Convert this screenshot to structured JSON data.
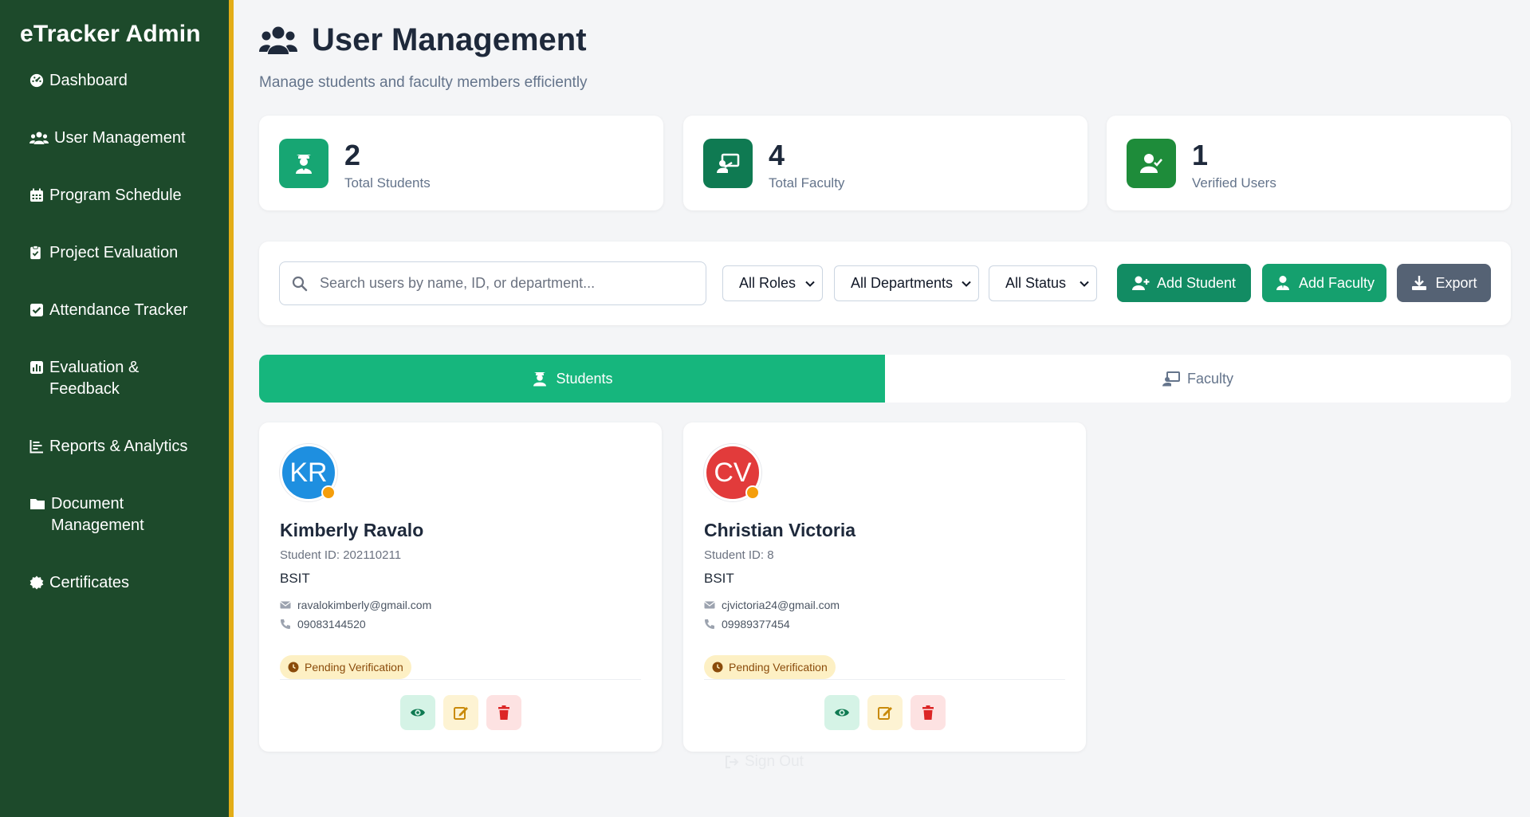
{
  "sidebar": {
    "brand": "eTracker Admin",
    "items": [
      {
        "label": "Dashboard",
        "icon": "dashboard-icon"
      },
      {
        "label": "User Management",
        "icon": "users-icon"
      },
      {
        "label": "Program Schedule",
        "icon": "calendar-icon"
      },
      {
        "label": "Project Evaluation",
        "icon": "clipboard-icon"
      },
      {
        "label": "Attendance Tracker",
        "icon": "check-square-icon"
      },
      {
        "label": "Evaluation & Feedback",
        "icon": "bar-chart-icon"
      },
      {
        "label": "Reports & Analytics",
        "icon": "line-chart-icon"
      },
      {
        "label": "Document Management",
        "icon": "folder-icon"
      },
      {
        "label": "Certificates",
        "icon": "certificate-icon"
      }
    ]
  },
  "header": {
    "title": "User Management",
    "subtitle": "Manage students and faculty members efficiently"
  },
  "stats": [
    {
      "value": "2",
      "label": "Total Students",
      "color": "#17a673",
      "icon": "graduate-icon"
    },
    {
      "value": "4",
      "label": "Total Faculty",
      "color": "#0f7a52",
      "icon": "teacher-icon"
    },
    {
      "value": "1",
      "label": "Verified Users",
      "color": "#1e8c3a",
      "icon": "user-check-icon"
    }
  ],
  "toolbar": {
    "search_placeholder": "Search users by name, ID, or department...",
    "roles_selected": "All Roles",
    "departments_selected": "All Departments",
    "status_selected": "All Status",
    "add_student_label": "Add Student",
    "add_faculty_label": "Add Faculty",
    "export_label": "Export"
  },
  "tabs": {
    "students": "Students",
    "faculty": "Faculty"
  },
  "users": [
    {
      "initials": "KR",
      "avatar_color": "#1e8fe0",
      "name": "Kimberly Ravalo",
      "id_line": "Student ID: 202110211",
      "department": "BSIT",
      "email": "ravalokimberly@gmail.com",
      "phone": "09083144520",
      "status": "Pending Verification"
    },
    {
      "initials": "CV",
      "avatar_color": "#e23b3b",
      "name": "Christian Victoria",
      "id_line": "Student ID: 8",
      "department": "BSIT",
      "email": "cjvictoria24@gmail.com",
      "phone": "09989377454",
      "status": "Pending Verification"
    }
  ],
  "signout_label": "Sign Out"
}
